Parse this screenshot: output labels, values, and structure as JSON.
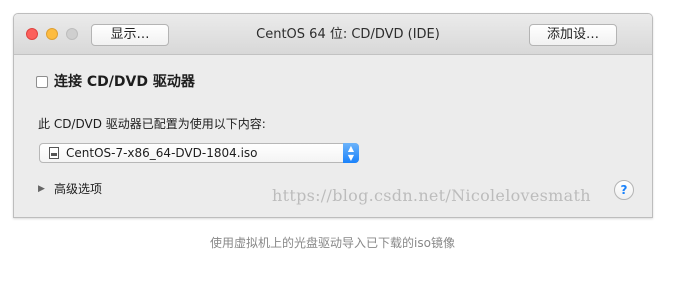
{
  "window": {
    "title": "CentOS 64 位: CD/DVD (IDE)",
    "show_button": "显示…",
    "add_device_button": "添加设…"
  },
  "connect": {
    "label": "连接 CD/DVD 驱动器",
    "checked": false
  },
  "config": {
    "description": "此 CD/DVD 驱动器已配置为使用以下内容:",
    "selected_file": "CentOS-7-x86_64-DVD-1804.iso",
    "file_icon": "iso-file-icon"
  },
  "advanced": {
    "label": "高级选项",
    "icon": "disclosure-triangle-icon"
  },
  "help": {
    "label": "?"
  },
  "watermark": "https://blog.csdn.net/Nicolelovesmath",
  "caption": "使用虚拟机上的光盘驱动导入已下载的iso镜像",
  "colors": {
    "close": "#fc605c",
    "minimize": "#fdbc40",
    "maximize_disabled": "#cfcfcf",
    "accent": "#1a82fb"
  }
}
